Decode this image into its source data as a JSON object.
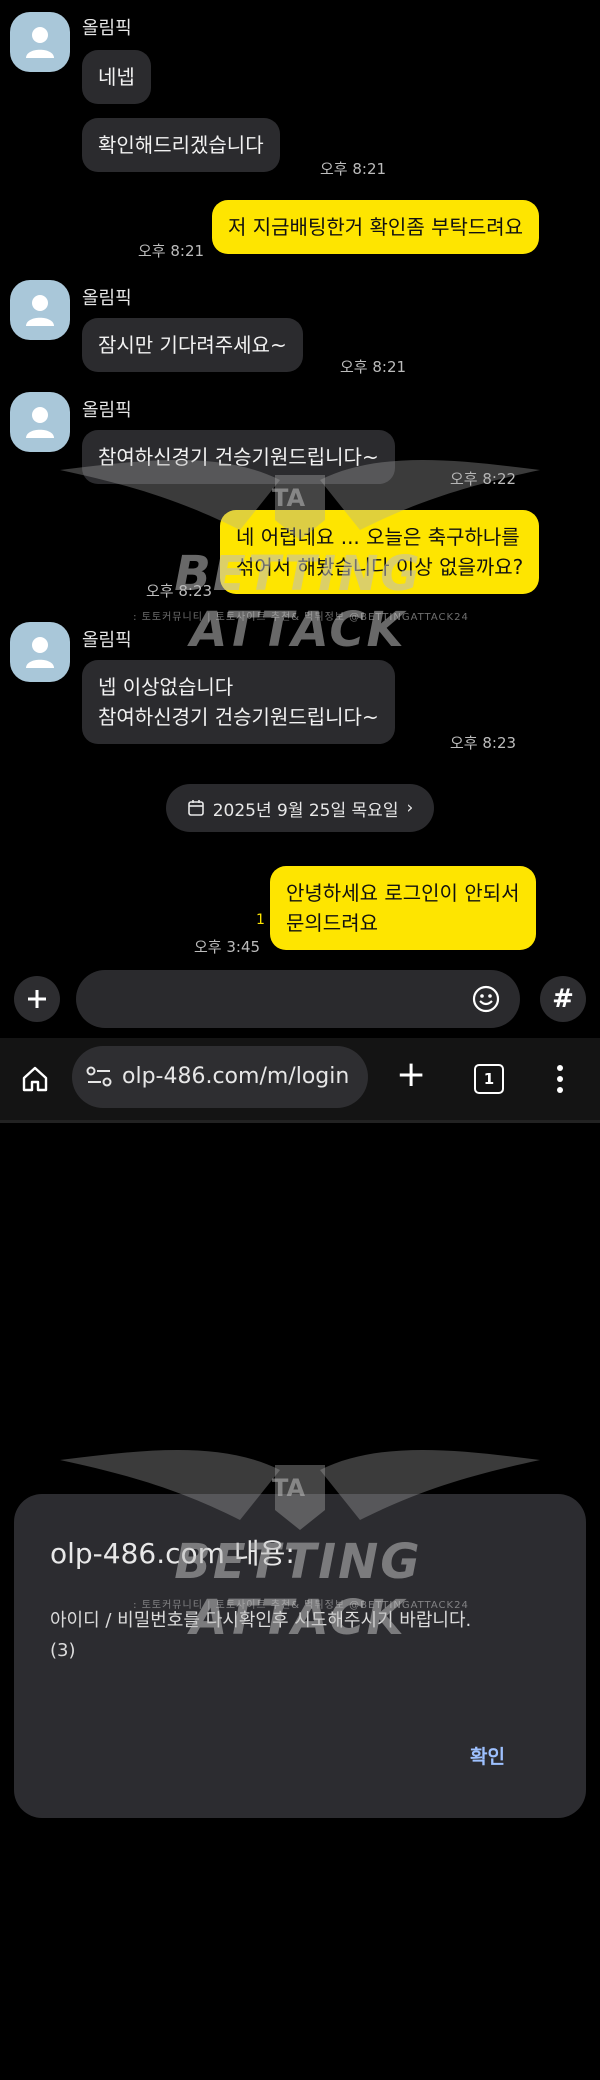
{
  "chat": {
    "sender_name": "올림픽",
    "messages": [
      {
        "from": "them",
        "text": "네넵"
      },
      {
        "from": "them",
        "text": "확인해드리겠습니다",
        "time": "오후 8:21"
      },
      {
        "from": "me",
        "text": "저 지금배팅한거 확인좀 부탁드려요",
        "time": "오후 8:21"
      },
      {
        "from": "them",
        "text": "잠시만 기다려주세요~",
        "time": "오후 8:21"
      },
      {
        "from": "them",
        "text": "참여하신경기 건승기원드립니다~",
        "time": "오후 8:22"
      },
      {
        "from": "me",
        "line1": "네 어렵네요 ... 오늘은 축구하나를",
        "line2": "섞어서 해봤습니다 이상 없을까요?",
        "time": "오후 8:23"
      },
      {
        "from": "them",
        "line1": "넵 이상없습니다",
        "line2": "참여하신경기 건승기원드립니다~",
        "time": "오후 8:23"
      },
      {
        "from": "me",
        "line1": "안녕하세요  로그인이 안되서",
        "line2": "문의드려요",
        "time": "오후 3:45",
        "unread": "1"
      }
    ],
    "date_divider": "2025년 9월 25일 목요일"
  },
  "input_bar": {
    "plus_icon": "plus-icon",
    "emoji_icon": "emoji-icon",
    "hash_label": "#"
  },
  "browser": {
    "url": "olp-486.com/m/login",
    "new_tab_label": "+",
    "tab_count": "1"
  },
  "dialog": {
    "title": "olp-486.com 내용:",
    "message_line1": "아이디 / 비밀번호를 다시확인후 시도해주시기 바랍니다.",
    "message_line2": "(3)",
    "ok_label": "확인"
  },
  "watermark": {
    "brand": "BETTING ATTACK",
    "badge": "TA",
    "tagline": ": 토토커뮤니티 | 토토사이트 추천& 먹튀정보 @BETTINGATTACK24"
  },
  "colors": {
    "my_bubble": "#fee500",
    "their_bubble": "#2b2b2e",
    "avatar": "#a9c7d9",
    "dialog_ok": "#9ec1ff"
  }
}
